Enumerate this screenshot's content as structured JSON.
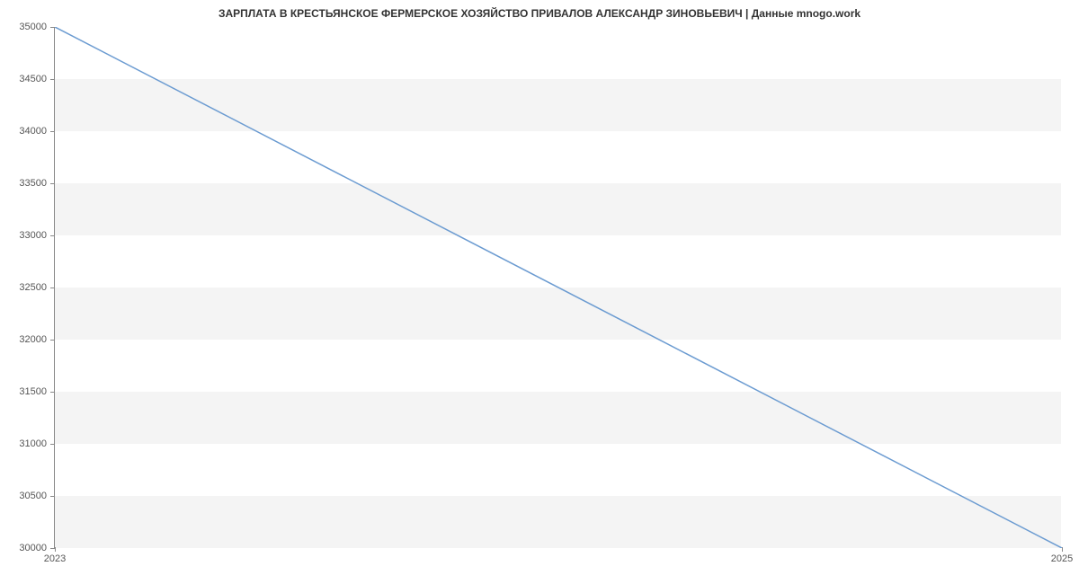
{
  "chart_data": {
    "type": "line",
    "title": "ЗАРПЛАТА В КРЕСТЬЯНСКОЕ ФЕРМЕРСКОЕ ХОЗЯЙСТВО ПРИВАЛОВ АЛЕКСАНДР ЗИНОВЬЕВИЧ | Данные mnogo.work",
    "x": [
      2023,
      2025
    ],
    "values": [
      35000,
      30000
    ],
    "xlabel": "",
    "ylabel": "",
    "x_ticks": [
      2023,
      2025
    ],
    "y_ticks": [
      30000,
      30500,
      31000,
      31500,
      32000,
      32500,
      33000,
      33500,
      34000,
      34500,
      35000
    ],
    "xlim": [
      2023,
      2025
    ],
    "ylim": [
      30000,
      35000
    ],
    "line_color": "#6b9bd1",
    "grid_band_color": "#f4f4f4"
  }
}
